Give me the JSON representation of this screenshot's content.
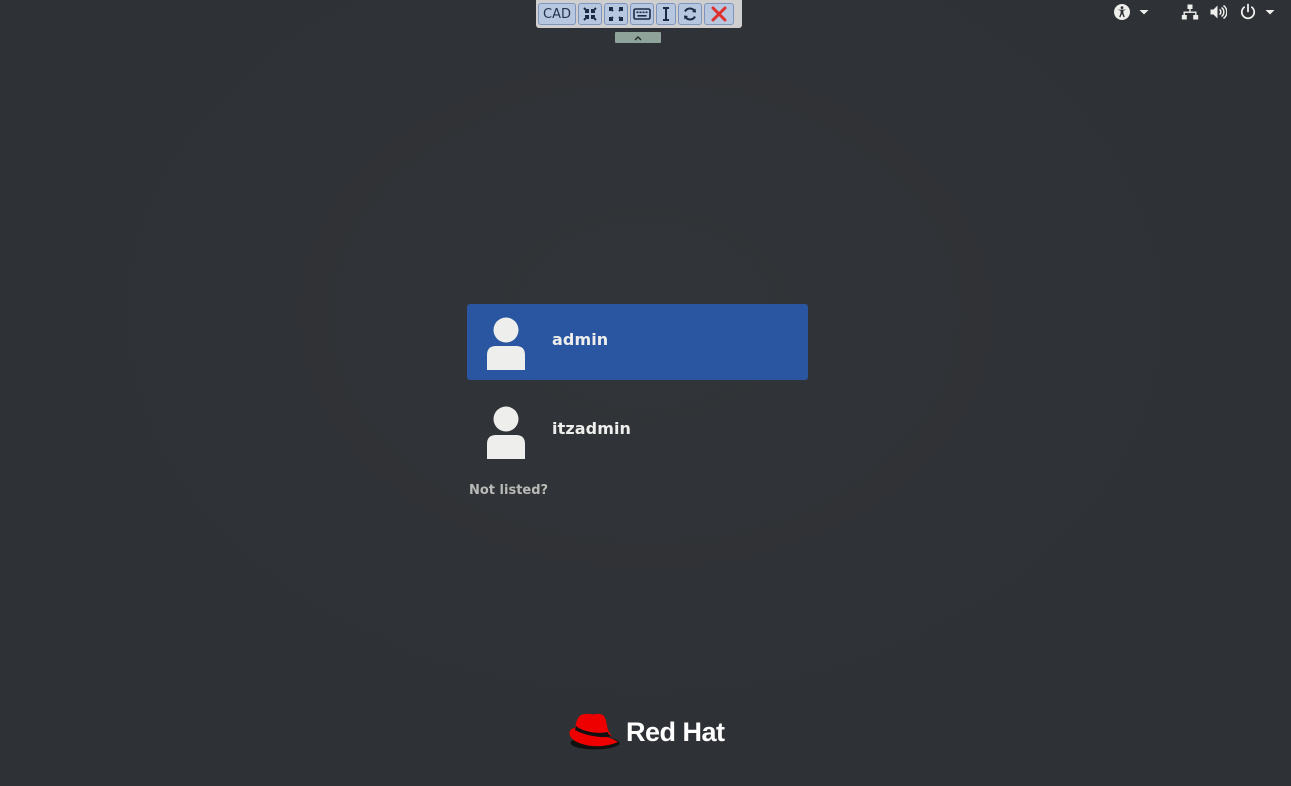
{
  "toolbar": {
    "cad_label": "CAD",
    "buttons": [
      {
        "icon": "exit-fullscreen-icon"
      },
      {
        "icon": "fullscreen-icon"
      },
      {
        "icon": "keyboard-icon"
      },
      {
        "icon": "text-cursor-icon"
      },
      {
        "icon": "refresh-icon"
      },
      {
        "icon": "disconnect-icon"
      }
    ],
    "handle_glyph": "^"
  },
  "tray": {
    "icons": [
      "accessibility-icon",
      "network-icon",
      "volume-icon",
      "power-icon"
    ]
  },
  "users": [
    {
      "name": "admin",
      "selected": true
    },
    {
      "name": "itzadmin",
      "selected": false
    }
  ],
  "not_listed_label": "Not listed?",
  "logo": {
    "text": "Red Hat"
  },
  "colors": {
    "background": "#2e3135",
    "selection": "#2a56a1",
    "text": "#eeeeec",
    "brand_red": "#ee0000"
  }
}
